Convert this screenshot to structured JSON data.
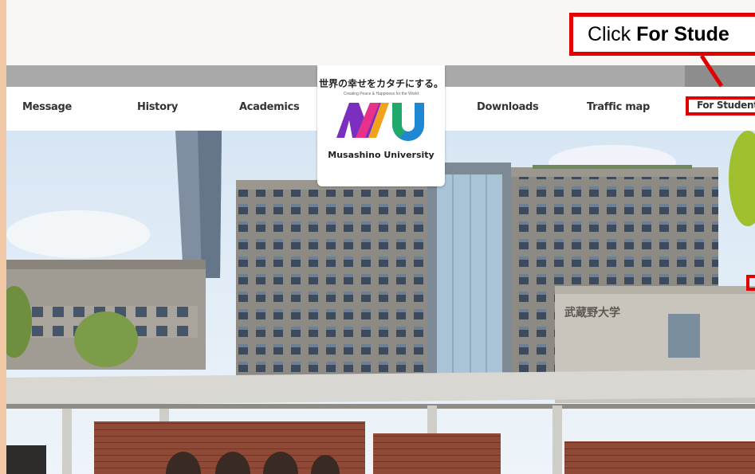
{
  "callout": {
    "prefix": "Click ",
    "bold": "For Stude"
  },
  "nav": {
    "items": [
      {
        "label": "Message"
      },
      {
        "label": "History"
      },
      {
        "label": "Academics"
      },
      {
        "label": "Downloads"
      },
      {
        "label": "Traffic map"
      },
      {
        "label": "For Student"
      }
    ]
  },
  "logo": {
    "tagline_jp": "世界の幸せをカタチにする。",
    "tagline_en": "Creating Peace & Happiness for the World",
    "monogram": "MU",
    "name": "Musashino University"
  },
  "building_sign": "武蔵野大学",
  "colors": {
    "highlight": "#e00000",
    "nav_band": "#a9a9a9"
  }
}
